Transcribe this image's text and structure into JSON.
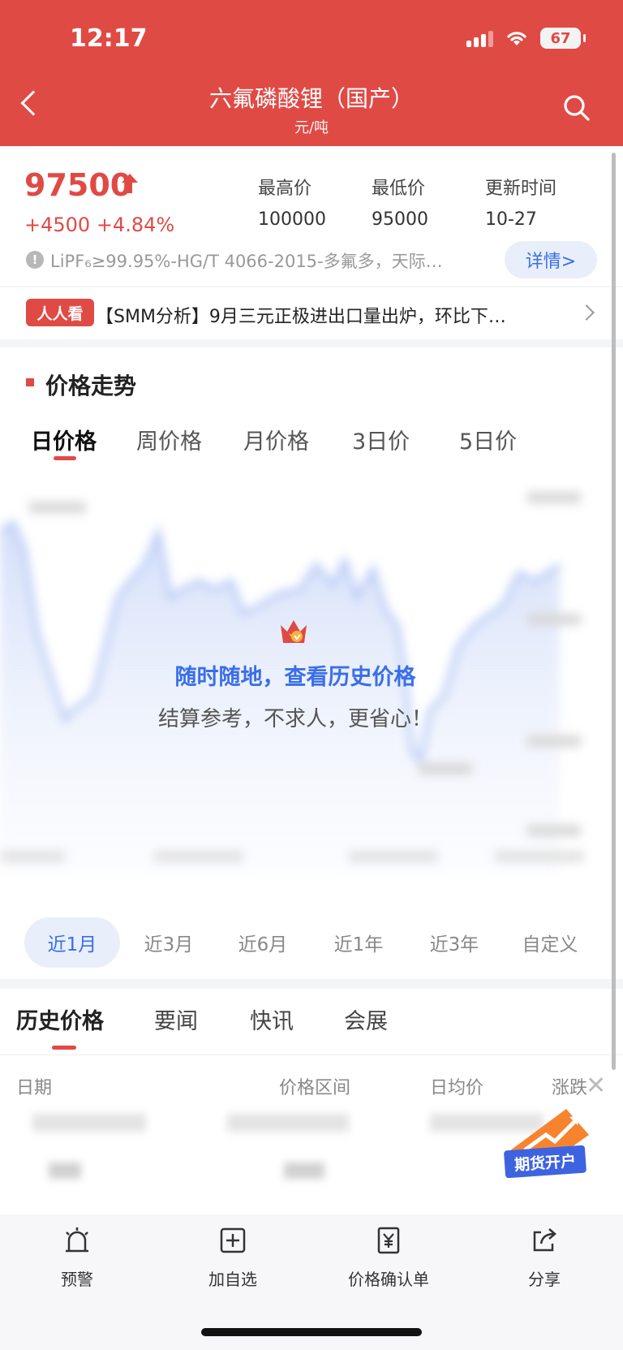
{
  "status_bar": {
    "time": "12:17",
    "battery": "67"
  },
  "nav": {
    "title": "六氟磷酸锂（国产）",
    "unit": "元/吨"
  },
  "quote": {
    "price": "97500",
    "change": "+4500 +4.84%",
    "stats": [
      {
        "label": "最高价",
        "value": "100000"
      },
      {
        "label": "最低价",
        "value": "95000"
      },
      {
        "label": "更新时间",
        "value": "10-27"
      }
    ],
    "spec": "LiPF₆≥99.95%-HG/T 4066-2015-多氟多，天际…",
    "detail_label": "详情>"
  },
  "news": {
    "tag": "人人看",
    "text": "【SMM分析】9月三元正极进出口量出炉，环比下…"
  },
  "trend": {
    "title": "价格走势",
    "tabs": [
      "日价格",
      "周价格",
      "月价格",
      "3日价",
      "5日价"
    ],
    "overlay_title": "随时随地，查看历史价格",
    "overlay_sub": "结算参考，不求人，更省心！"
  },
  "ranges": [
    "近1月",
    "近3月",
    "近6月",
    "近1年",
    "近3年",
    "自定义"
  ],
  "bottom_tabs": [
    "历史价格",
    "要闻",
    "快讯",
    "会展"
  ],
  "table_headers": [
    "日期",
    "价格区间",
    "日均价",
    "涨跌"
  ],
  "promo_label": "期货开户",
  "toolbar": [
    {
      "label": "预警",
      "icon": "alarm-icon"
    },
    {
      "label": "加自选",
      "icon": "add-square-icon"
    },
    {
      "label": "价格确认单",
      "icon": "yuan-doc-icon"
    },
    {
      "label": "分享",
      "icon": "share-icon"
    }
  ],
  "colors": {
    "brand_red": "#e04a45",
    "accent_blue": "#3a6ee8"
  }
}
